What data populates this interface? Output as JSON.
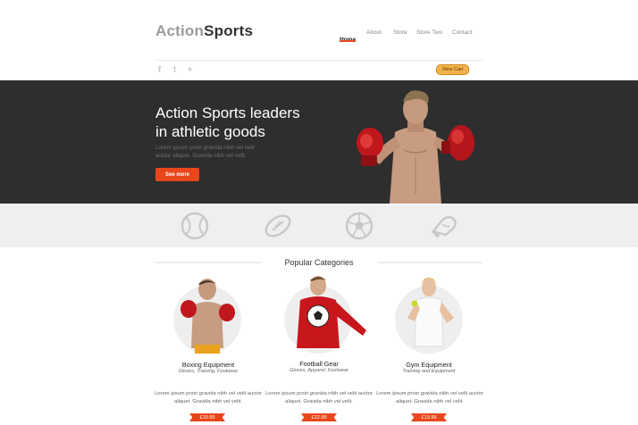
{
  "header": {
    "logo_part1": "Action",
    "logo_part2": "Sports",
    "nav": [
      "Home",
      "About",
      "Store",
      "Store Two",
      "Contact"
    ],
    "view_cart": "View Cart"
  },
  "social_icons": [
    "facebook-icon",
    "twitter-icon",
    "plus-icon"
  ],
  "hero": {
    "title_line1": "Action Sports leaders",
    "title_line2": "in athletic goods",
    "text": "Lorem ipsum proin gravida nibh vel velit auctor aliquet. Gravida nibh vel velit.",
    "button": "See more"
  },
  "sport_icons": [
    "baseball-icon",
    "football-icon",
    "soccer-ball-icon",
    "boxing-glove-icon"
  ],
  "section_title": "Popular Categories",
  "categories": [
    {
      "title": "Boxing Equipment",
      "sub": "Gloves, Training, Footwear",
      "text": "Lorem ipsum proin gravida nibh vel velit auctor aliquet. Gravida nibh vel velit.",
      "price": "£19.99"
    },
    {
      "title": "Football Gear",
      "sub": "Gloves, Apparel, Footwear",
      "text": "Lorem ipsum proin gravida nibh vel velit auctor aliquet. Gravida nibh vel velit.",
      "price": "£12.99"
    },
    {
      "title": "Gym Equipment",
      "sub": "Training and Equipment",
      "text": "Lorem ipsum proin gravida nibh vel velit auctor aliquet. Gravida nibh vel velit.",
      "price": "£19.99"
    }
  ],
  "colors": {
    "accent": "#e8471b",
    "hero_bg": "#2e2e2e",
    "strip_bg": "#efefef",
    "cart": "#f2b14a"
  }
}
